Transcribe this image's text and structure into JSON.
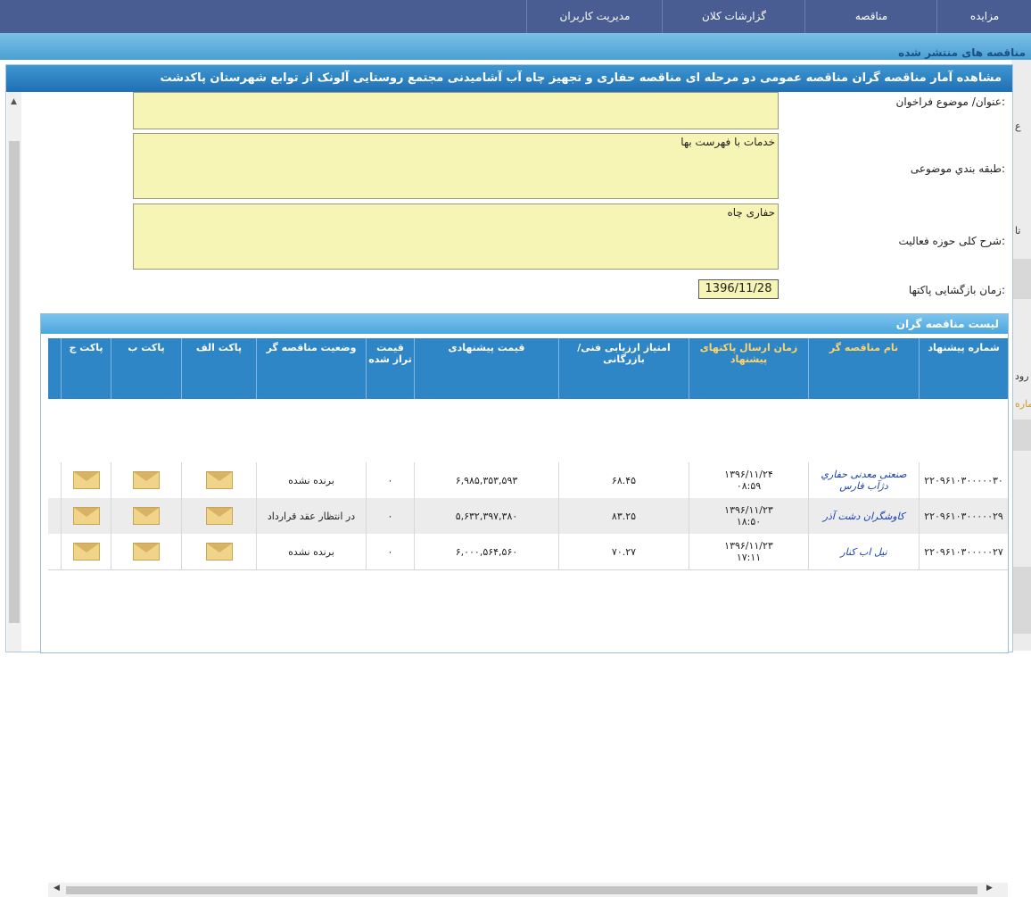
{
  "nav": {
    "items": [
      "مزایده",
      "مناقصه",
      "گزارشات کلان",
      "مدیریت کاربران"
    ]
  },
  "background": {
    "section_title": "مناقصه های منتشر شده",
    "side_texts": [
      "ع",
      "تا",
      "رود",
      "شماره"
    ]
  },
  "modal": {
    "title": "مشاهده آمار مناقصه گران مناقصه عمومی دو مرحله ای مناقصه حفاری و تجهیز چاه آب آشامیدنی مجتمع روستایی آلونک از توابع شهرستان پاکدشت",
    "fields": {
      "subject_label": "عنوان/ موضوع فراخوان:",
      "category_label": "طبقه بندي موضوعی:",
      "category_value": "خدمات با فهرست بها",
      "activity_label": "شرح کلی حوزه فعالیت:",
      "activity_value": "حفاری چاه",
      "opening_label": "زمان بازگشایی پاکتها:",
      "opening_value": "1396/11/28"
    }
  },
  "list": {
    "title": "لیست مناقصه گران",
    "columns": {
      "number": "شماره پیشنهاد",
      "name": "نام مناقصه گر",
      "send_time": "زمان ارسال پاکتهای پیشنهاد",
      "score": "امتیاز ارزیابی فنی/ بازرگانی",
      "price": "قیمت پیشنهادی",
      "balanced": "قیمت تراز شده",
      "status": "وضعیت مناقصه گر",
      "packet_a": "پاکت الف",
      "packet_b": "پاکت ب",
      "packet_c": "پاکت ج"
    },
    "rows": [
      {
        "number": "۲۲۰۹۶۱۰۳۰۰۰۰۰۳۰",
        "name": "صنعتی معدنی حفاري دژآب فارس",
        "send_date": "۱۳۹۶/۱۱/۲۴",
        "send_time": "۰۸:۵۹",
        "score": "۶۸.۴۵",
        "price": "۶,۹۸۵,۳۵۳,۵۹۳",
        "balanced": "۰",
        "status": "برنده نشده"
      },
      {
        "number": "۲۲۰۹۶۱۰۳۰۰۰۰۰۲۹",
        "name": "کاوشگران دشت آذر",
        "send_date": "۱۳۹۶/۱۱/۲۳",
        "send_time": "۱۸:۵۰",
        "score": "۸۳.۲۵",
        "price": "۵,۶۳۲,۳۹۷,۳۸۰",
        "balanced": "۰",
        "status": "در انتظار عقد قرارداد"
      },
      {
        "number": "۲۲۰۹۶۱۰۳۰۰۰۰۰۲۷",
        "name": "نیل اب کنار",
        "send_date": "۱۳۹۶/۱۱/۲۳",
        "send_time": "۱۷:۱۱",
        "score": "۷۰.۲۷",
        "price": "۶,۰۰۰,۵۶۴,۵۶۰",
        "balanced": "۰",
        "status": "برنده نشده"
      }
    ]
  },
  "colors": {
    "nav_bg": "#4a5d93",
    "header_blue": "#1f6fb4",
    "table_header": "#2f86c6",
    "field_bg": "#f7f5b5",
    "link": "#1a3fb5"
  }
}
